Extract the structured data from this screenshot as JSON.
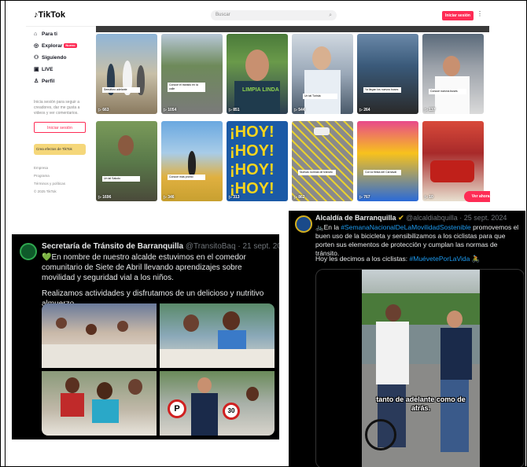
{
  "tiktok": {
    "logo": "TikTok",
    "search_placeholder": "Buscar",
    "login_button": "Iniciar sesión",
    "nav": [
      {
        "label": "Para ti",
        "icon": "home-icon"
      },
      {
        "label": "Explorar",
        "icon": "compass-icon",
        "badge": "Nuevo"
      },
      {
        "label": "Siguiendo",
        "icon": "users-icon"
      },
      {
        "label": "LIVE",
        "icon": "live-icon"
      },
      {
        "label": "Perfil",
        "icon": "user-icon"
      }
    ],
    "side_text": "Inicia sesión para seguir a creadores, dar me gusta a videos y ver comentarios.",
    "side_login": "Iniciar sesión",
    "effects": "Crea efectos de TikTok",
    "links": [
      "Empresa",
      "Programa",
      "Términos y políticas",
      "© 2025 TikTok"
    ],
    "watch_button": "Ver ahora",
    "row1": [
      {
        "views": "663",
        "caption": "Semáforo adelante"
      },
      {
        "views": "1054",
        "caption": "Conoce el tránsito en la calle"
      },
      {
        "views": "851",
        "caption": "LIMPIA LINDA"
      },
      {
        "views": "544",
        "caption": "Un tal Turista"
      },
      {
        "views": "264",
        "caption": "Ya llegan los nuevos buses"
      },
      {
        "views": "137",
        "caption": "Conoce nuevos buses"
      }
    ],
    "row2": [
      {
        "views": "1696",
        "caption": "Un tal Saludo"
      },
      {
        "views": "346",
        "caption": "Conoce más pronto"
      },
      {
        "views": "313",
        "caption": "¡HOY!"
      },
      {
        "views": "862",
        "caption": "Nuevas normas de tránsito"
      },
      {
        "views": "767",
        "caption": "Con la fiesta del Carnaval"
      },
      {
        "views": "10",
        "caption": ""
      }
    ]
  },
  "tweet_left": {
    "name": "Secretaría de Tránsito de Barranquilla",
    "handle": "@TransitoBaq · 21 sept. 2024",
    "text1": "💚En nombre de nuestro alcalde estuvimos en el comedor comunitario de Siete de Abril llevando aprendizajes sobre movilidad y seguridad vial a los niños.",
    "text2": "Realizamos actividades y disfrutamos de un delicioso y nutritivo almuerzo."
  },
  "tweet_right": {
    "name": "Alcaldía de Barranquilla",
    "handle": "@alcaldiabquilla · 25 sept. 2024",
    "text_prefix": "🚲En la ",
    "hashtag1": "#SemanaNacionalDeLaMovilidadSostenible",
    "text_rest": " promovemos el buen uso de la bicicleta y sensibilizamos a los ciclistas para que porten sus elementos de protección y cumplan las normas de tránsito.",
    "text2_prefix": "Hoy les decimos a los ciclistas: ",
    "hashtag2": "#MuévetePorLaVida",
    "video_caption": "tanto de adelante como de atrás."
  }
}
